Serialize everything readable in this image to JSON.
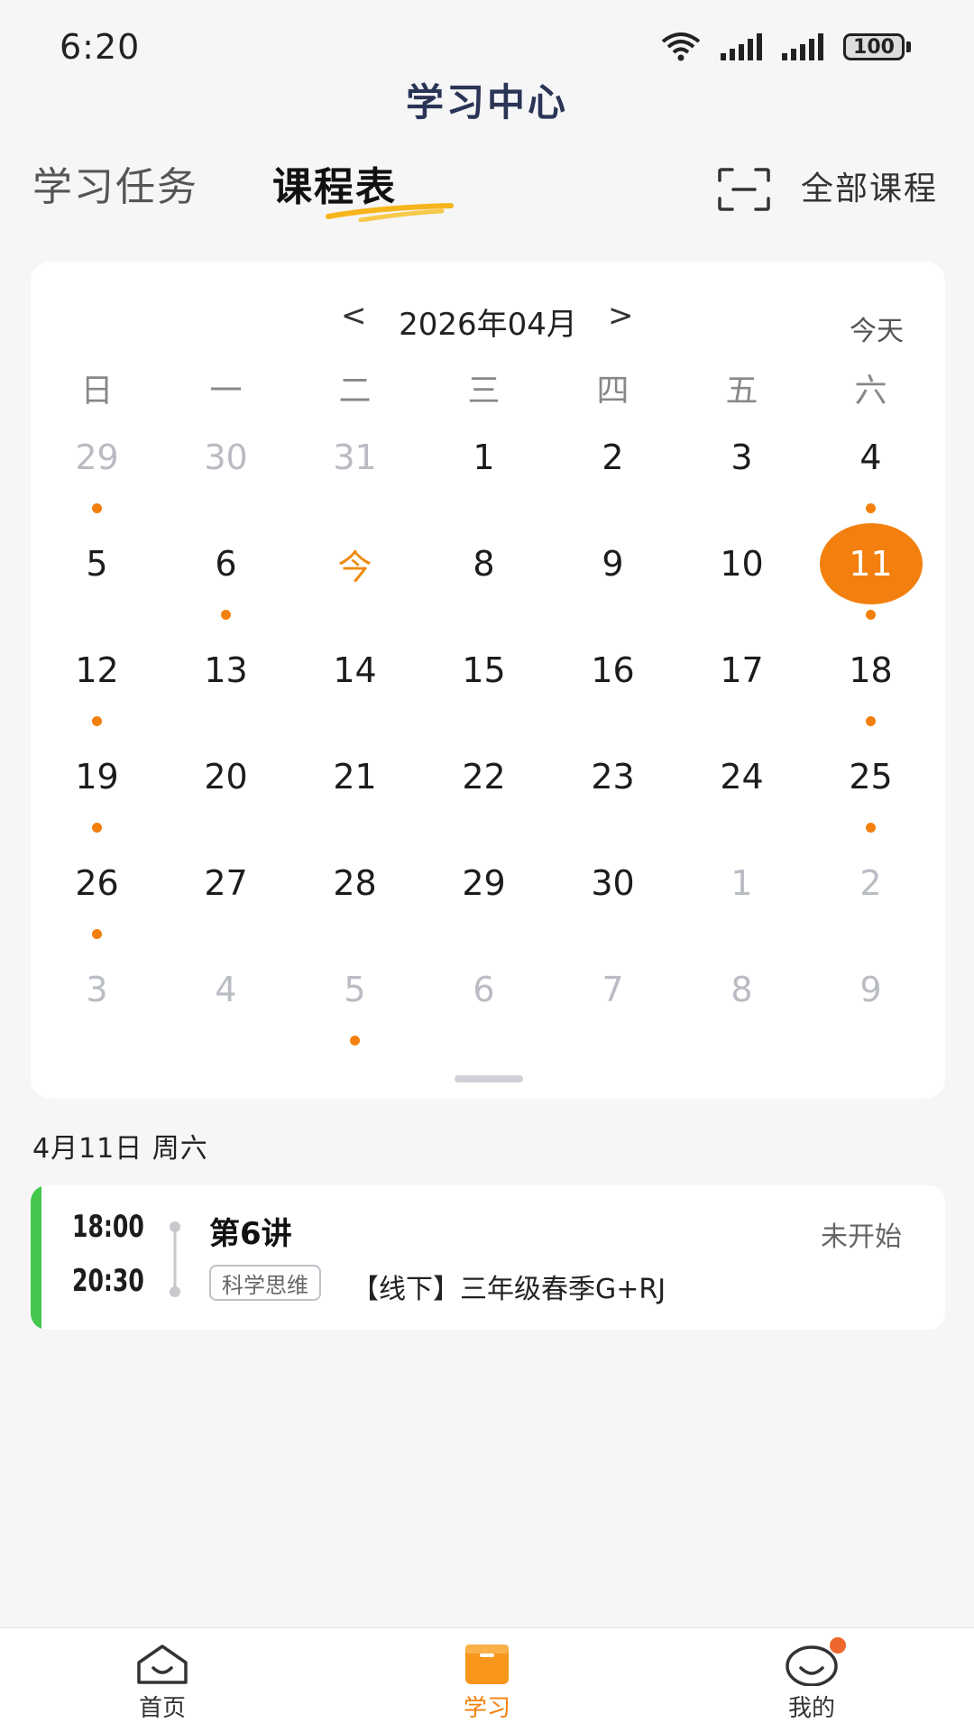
{
  "status_bar": {
    "time": "6:20",
    "battery": "100"
  },
  "header": {
    "title": "学习中心"
  },
  "tabs": [
    {
      "label": "学习任务",
      "active": false
    },
    {
      "label": "课程表",
      "active": true
    }
  ],
  "all_courses_label": "全部课程",
  "calendar": {
    "month_label": "2026年04月",
    "prev": "<",
    "next": ">",
    "today_label": "今天",
    "weekdays": [
      "日",
      "一",
      "二",
      "三",
      "四",
      "五",
      "六"
    ],
    "weeks": [
      [
        {
          "label": "29",
          "dim": true,
          "dot": true
        },
        {
          "label": "30",
          "dim": true
        },
        {
          "label": "31",
          "dim": true
        },
        {
          "label": "1"
        },
        {
          "label": "2"
        },
        {
          "label": "3"
        },
        {
          "label": "4",
          "dot": true
        }
      ],
      [
        {
          "label": "5"
        },
        {
          "label": "6",
          "dot": true
        },
        {
          "label": "今",
          "today": true
        },
        {
          "label": "8"
        },
        {
          "label": "9"
        },
        {
          "label": "10"
        },
        {
          "label": "11",
          "selected": true,
          "dot": true
        }
      ],
      [
        {
          "label": "12",
          "dot": true
        },
        {
          "label": "13"
        },
        {
          "label": "14"
        },
        {
          "label": "15"
        },
        {
          "label": "16"
        },
        {
          "label": "17"
        },
        {
          "label": "18",
          "dot": true
        }
      ],
      [
        {
          "label": "19",
          "dot": true
        },
        {
          "label": "20"
        },
        {
          "label": "21"
        },
        {
          "label": "22"
        },
        {
          "label": "23"
        },
        {
          "label": "24"
        },
        {
          "label": "25",
          "dot": true
        }
      ],
      [
        {
          "label": "26",
          "dot": true
        },
        {
          "label": "27"
        },
        {
          "label": "28"
        },
        {
          "label": "29"
        },
        {
          "label": "30"
        },
        {
          "label": "1",
          "dim": true
        },
        {
          "label": "2",
          "dim": true
        }
      ],
      [
        {
          "label": "3",
          "dim": true
        },
        {
          "label": "4",
          "dim": true
        },
        {
          "label": "5",
          "dim": true,
          "dot": true
        },
        {
          "label": "6",
          "dim": true
        },
        {
          "label": "7",
          "dim": true
        },
        {
          "label": "8",
          "dim": true
        },
        {
          "label": "9",
          "dim": true
        }
      ]
    ]
  },
  "selected_date_heading": "4月11日 周六",
  "course": {
    "start_time": "18:00",
    "end_time": "20:30",
    "lesson": "第6讲",
    "status": "未开始",
    "tag": "科学思维",
    "name": "【线下】三年级春季G+RJ"
  },
  "bottom_nav": [
    {
      "label": "首页",
      "icon": "home-icon",
      "active": false
    },
    {
      "label": "学习",
      "icon": "study-icon",
      "active": true
    },
    {
      "label": "我的",
      "icon": "profile-icon",
      "active": false
    }
  ],
  "colors": {
    "accent": "#f3800e",
    "course_accent": "#43c74d",
    "title": "#2a3556"
  }
}
